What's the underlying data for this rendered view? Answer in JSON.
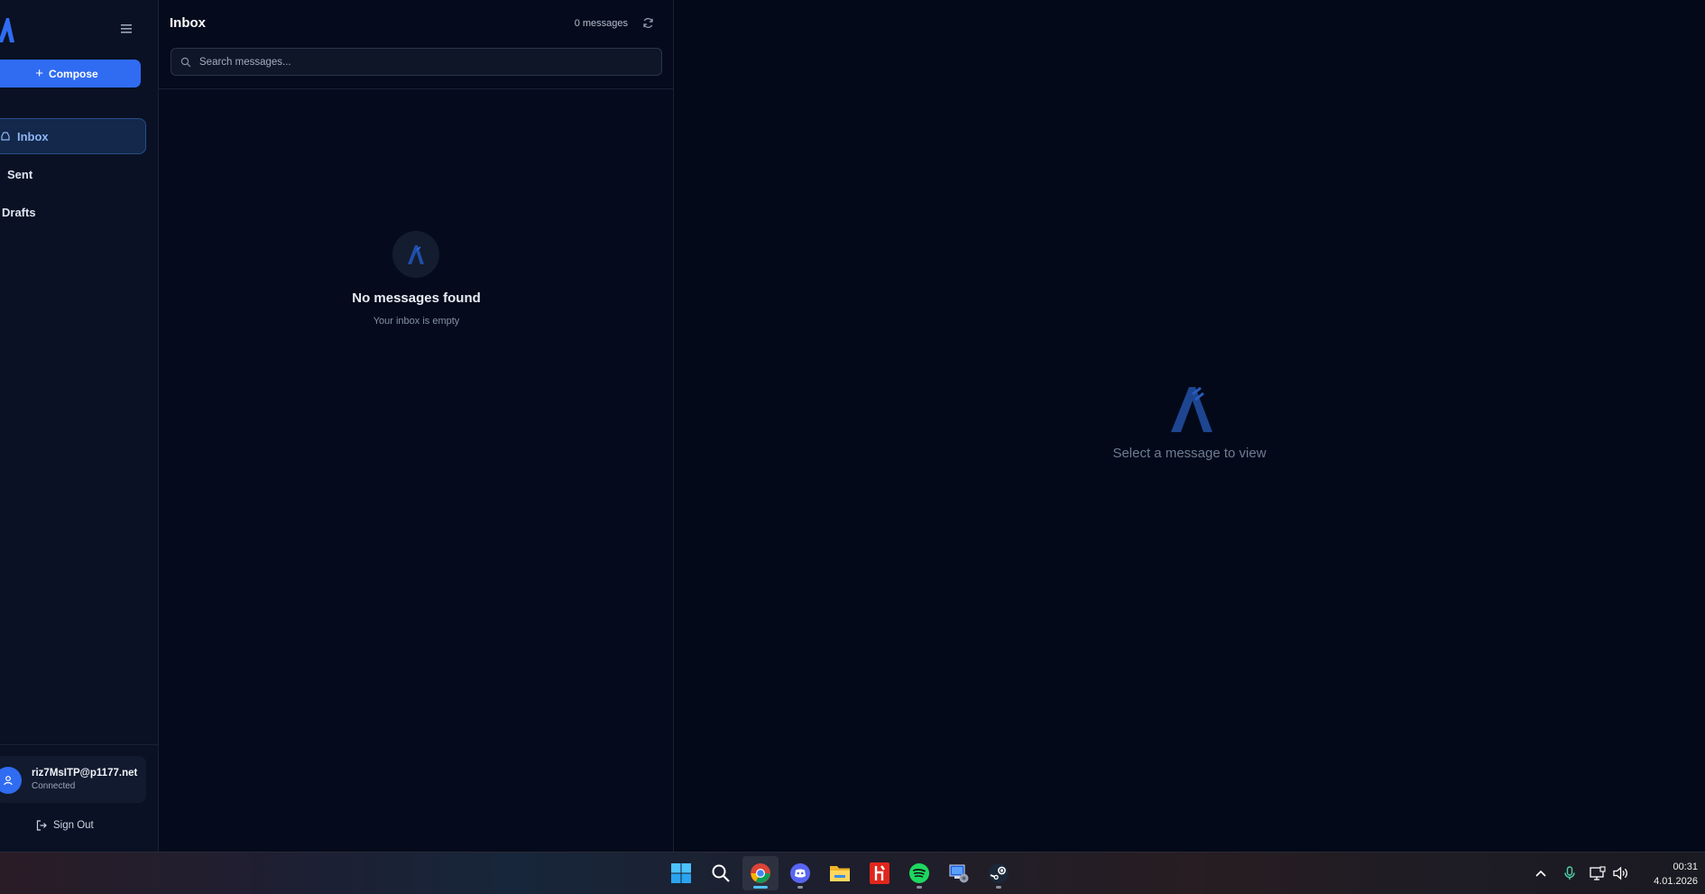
{
  "sidebar": {
    "compose_label": "Compose",
    "items": [
      {
        "label": "Inbox",
        "active": true
      },
      {
        "label": "Sent",
        "active": false
      },
      {
        "label": "Drafts",
        "active": false
      }
    ],
    "account": {
      "email": "riz7MsITP@p1177.net",
      "status": "Connected"
    },
    "signout_label": "Sign Out"
  },
  "list": {
    "title": "Inbox",
    "count_text": "0 messages",
    "search_placeholder": "Search messages...",
    "empty_title": "No messages found",
    "empty_subtitle": "Your inbox is empty"
  },
  "reader": {
    "placeholder": "Select a message to view"
  },
  "taskbar": {
    "apps": [
      "start-icon",
      "search-icon",
      "chrome-icon",
      "discord-icon",
      "file-explorer-icon",
      "red-app-icon",
      "spotify-icon",
      "network-app-icon",
      "steam-icon"
    ],
    "clock_time": "00:31",
    "clock_date": "4.01.2026"
  },
  "colors": {
    "accent": "#2f6cf2",
    "background": "#050b1c",
    "sidebar": "#0a1124",
    "logo": "#1f4fa8"
  }
}
